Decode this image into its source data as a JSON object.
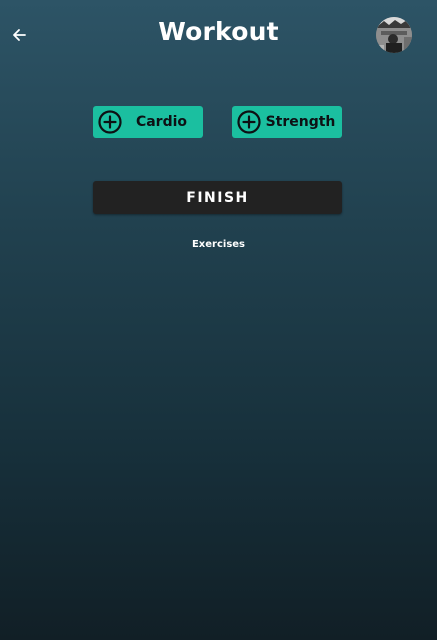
{
  "header": {
    "title": "Workout",
    "back_icon": "arrow-left-icon",
    "avatar_icon": "profile-avatar"
  },
  "actions": {
    "cardio_label": "Cardio",
    "strength_label": "Strength",
    "add_icon": "plus-circle-icon",
    "finish_label": "FINISH"
  },
  "section": {
    "exercises_label": "Exercises"
  },
  "colors": {
    "accent": "#1bbfa0",
    "finish_bg": "#222222",
    "bg_top": "#2d5466",
    "bg_bottom": "#111f26"
  }
}
